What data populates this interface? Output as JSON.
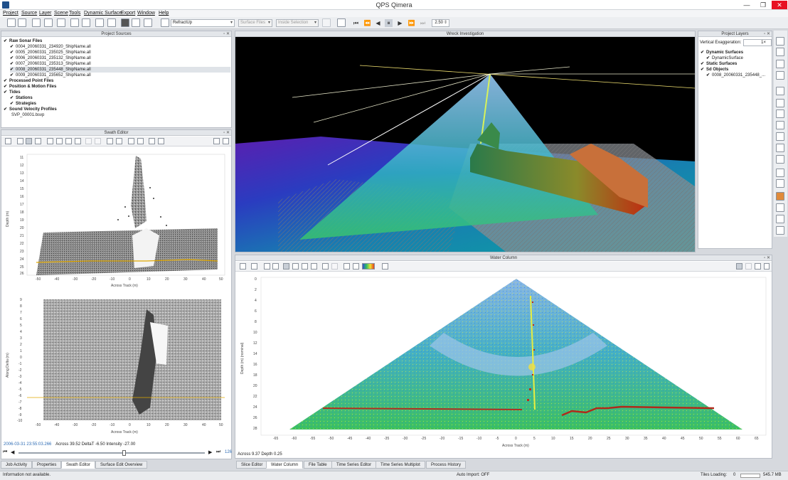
{
  "window": {
    "title": "QPS Qimera",
    "minimize": "—",
    "maximize": "❐",
    "close": "✕"
  },
  "menu": [
    "Project",
    "Source",
    "Layer",
    "Scene",
    "Tools",
    "Dynamic Surface",
    "Export",
    "Window",
    "Help"
  ],
  "toolbar": {
    "workflow_combo": "RefractUp",
    "surfaces_combo": "Surface Files",
    "selection_combo": "Inside Selection",
    "speed": "2.50"
  },
  "project_sources": {
    "title": "Project Sources",
    "raw_sonar": "Raw Sonar Files",
    "files": [
      "0004_20060331_234920_ShipName.all",
      "0005_20060331_235025_ShipName.all",
      "0006_20060331_235132_ShipName.all",
      "0007_20060331_235313_ShipName.all",
      "0008_20060331_235448_ShipName.all",
      "0009_20060331_235652_ShipName.all"
    ],
    "processed": "Processed Point Files",
    "position": "Position & Motion Files",
    "tides": "Tides",
    "stations": "Stations",
    "strategies": "Strategies",
    "svp": "Sound Velocity Profiles",
    "svp_file": "SVP_00001.bsvp"
  },
  "swath_editor": {
    "title": "Swath Editor",
    "top_ylabel": "Depth (m)",
    "top_xlabel": "Across Track (m)",
    "bottom_ylabel": "Along Delta (m)",
    "bottom_xlabel": "Across Track (m)",
    "top_yticks": [
      "11",
      "12",
      "13",
      "14",
      "15",
      "16",
      "17",
      "18",
      "19",
      "20",
      "21",
      "22",
      "23",
      "24",
      "25",
      "26"
    ],
    "xticks": [
      "-50",
      "-40",
      "-30",
      "-20",
      "-10",
      "0",
      "10",
      "20",
      "30",
      "40",
      "50"
    ],
    "bottom_yticks": [
      "9",
      "8",
      "7",
      "6",
      "5",
      "4",
      "3",
      "2",
      "1",
      "0",
      "-1",
      "-2",
      "-3",
      "-4",
      "-5",
      "-6",
      "-7",
      "-8",
      "-9",
      "-10"
    ],
    "status_time": "2006-03-31 23:55:03.266",
    "status_values": "Across 39.52  DeltaT -6.50  Intensity -27.00",
    "ping_count": "126"
  },
  "wreck_view": {
    "title": "Wreck Investigation"
  },
  "project_layers": {
    "title": "Project Layers",
    "vert_exag_label": "Vertical Exaggeration:",
    "vert_exag_value": "1×",
    "dynamic": "Dynamic Surfaces",
    "dynamic_child": "DynamicSurface",
    "static": "Static Surfaces",
    "sd_objects": "Sd Objects",
    "sd_child": "0008_20060331_235448_..."
  },
  "water_column": {
    "title": "Water Column",
    "ylabel": "Depth (m) (nominal)",
    "xlabel": "Across Track (m)",
    "yticks": [
      "0",
      "2",
      "4",
      "6",
      "8",
      "10",
      "12",
      "14",
      "16",
      "18",
      "20",
      "22",
      "24",
      "26",
      "28"
    ],
    "xticks": [
      "-65",
      "-60",
      "-55",
      "-50",
      "-45",
      "-40",
      "-35",
      "-30",
      "-25",
      "-20",
      "-15",
      "-10",
      "-5",
      "0",
      "5",
      "10",
      "15",
      "20",
      "25",
      "30",
      "35",
      "40",
      "45",
      "50",
      "55",
      "60",
      "65"
    ],
    "status": "Across 9.37  Depth 0.25"
  },
  "left_tabs": [
    "Job Activity",
    "Properties",
    "Swath Editor",
    "Surface Edit Overview"
  ],
  "bottom_tabs": [
    "Slice Editor",
    "Water Column",
    "File Table",
    "Time Series Editor",
    "Time Series Multiplot",
    "Process History"
  ],
  "status": {
    "left": "Information not available.",
    "auto_import": "Auto Import: OFF",
    "tiles": "Tiles Loading:",
    "tiles_count": "0",
    "memory": "545.7 MB"
  }
}
